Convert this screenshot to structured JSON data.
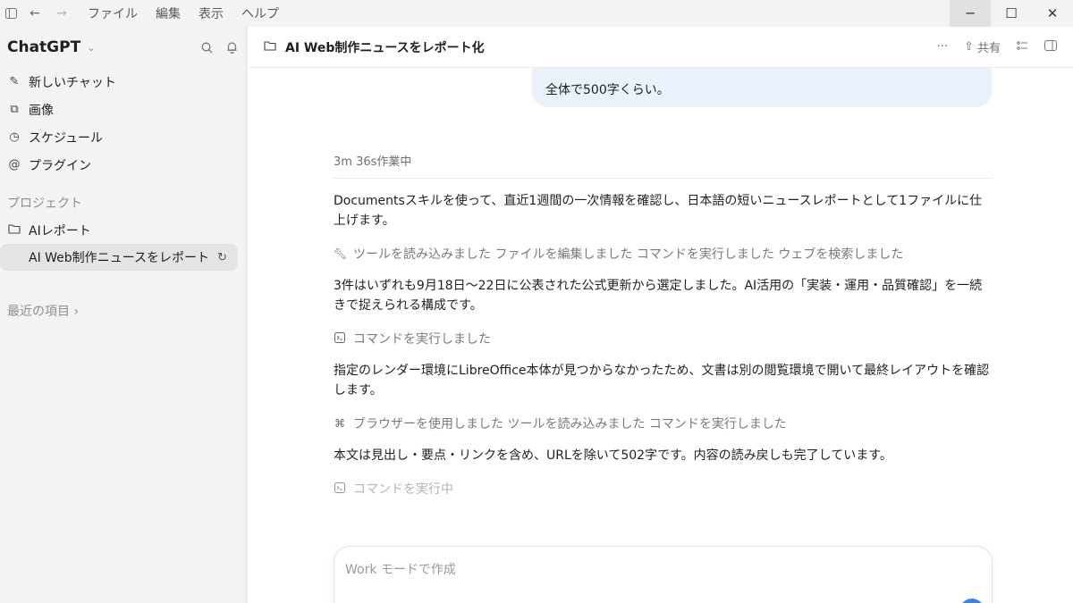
{
  "titlebar": {
    "menu": [
      "ファイル",
      "編集",
      "表示",
      "ヘルプ"
    ],
    "icons": [
      "sidebar-toggle-icon",
      "back-arrow-icon",
      "forward-arrow-icon"
    ]
  },
  "sidebar": {
    "brand": "ChatGPT",
    "nav": [
      {
        "label": "新しいチャット",
        "icon": "new-chat-icon"
      },
      {
        "label": "画像",
        "icon": "image-icon"
      },
      {
        "label": "スケジュール",
        "icon": "clock-icon"
      },
      {
        "label": "プラグイン",
        "icon": "at-icon"
      }
    ],
    "projects_heading": "プロジェクト",
    "project": {
      "label": "AIレポート",
      "icon": "folder-icon"
    },
    "active_chat": "AI Web制作ニュースをレポート",
    "recent": "最近の項目 ›"
  },
  "header": {
    "title": "AI Web制作ニュースをレポート化",
    "share": "共有"
  },
  "conversation": {
    "user_bubble": "全体で500字くらい。",
    "status": "3m 36s作業中",
    "p1": "Documentsスキルを使って、直近1週間の一次情報を確認し、日本語の短いニュースレポートとして1ファイルに仕上げます。",
    "a1": "ツールを読み込みました ファイルを編集しました コマンドを実行しました ウェブを検索しました",
    "p2": "3件はいずれも9月18日〜22日に公表された公式更新から選定しました。AI活用の「実装・運用・品質確認」を一続きで捉えられる構成です。",
    "a2": "コマンドを実行しました",
    "p3": "指定のレンダー環境にLibreOffice本体が見つからなかったため、文書は別の閲覧環境で開いて最終レイアウトを確認します。",
    "a3": "ブラウザーを使用しました ツールを読み込みました コマンドを実行しました",
    "p4": "本文は見出し・要点・リンクを含め、URLを除いて502字です。内容の読み戻しも完了しています。",
    "a4": "コマンドを実行中"
  },
  "composer": {
    "placeholder": "Work モードで作成"
  },
  "colors": {
    "bubble": "#e9f1fb",
    "active_chat_bg": "#e4e4e4",
    "accent": "#3b82f6"
  }
}
